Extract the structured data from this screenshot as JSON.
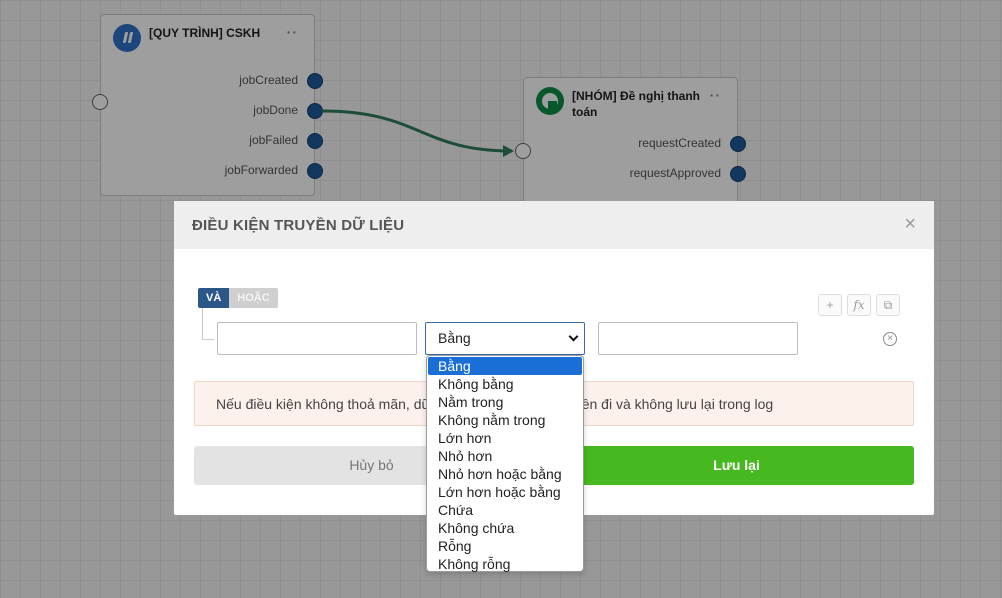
{
  "canvas": {
    "node_cskh": {
      "title": "[QUY TRÌNH] CSKH",
      "ports": [
        "jobCreated",
        "jobDone",
        "jobFailed",
        "jobForwarded"
      ]
    },
    "node_nhom": {
      "title": "[NHÓM] Đề nghị thanh toán",
      "ports": [
        "requestCreated",
        "requestApproved"
      ]
    }
  },
  "modal": {
    "title": "ĐIỀU KIỆN TRUYỀN DỮ LIỆU",
    "close_label": "×",
    "logic": {
      "and_label": "VÀ",
      "or_label": "HOẶC",
      "active": "and"
    },
    "tools": {
      "add_label": "+",
      "fx_label": "fx",
      "copy_label": "⧉"
    },
    "condition": {
      "left_value": "",
      "operator_selected": "Bằng",
      "right_value": ""
    },
    "notice": "Nếu điều kiện không thoả mãn, dữ liệu sẽ không được truyền đi và không lưu lại trong log",
    "cancel_label": "Hủy bỏ",
    "save_label": "Lưu lại"
  },
  "dropdown": {
    "options": [
      "Bằng",
      "Không bằng",
      "Nằm trong",
      "Không nằm trong",
      "Lớn hơn",
      "Nhỏ hơn",
      "Nhỏ hơn hoặc bằng",
      "Lớn hơn hoặc bằng",
      "Chứa",
      "Không chứa",
      "Rỗng",
      "Không rỗng"
    ],
    "selected_index": 0
  },
  "colors": {
    "accent": "#2a5787",
    "save": "#45b91f",
    "edge": "#2e7d5b",
    "port": "#1f5b99",
    "selection": "#1a6fd6"
  }
}
